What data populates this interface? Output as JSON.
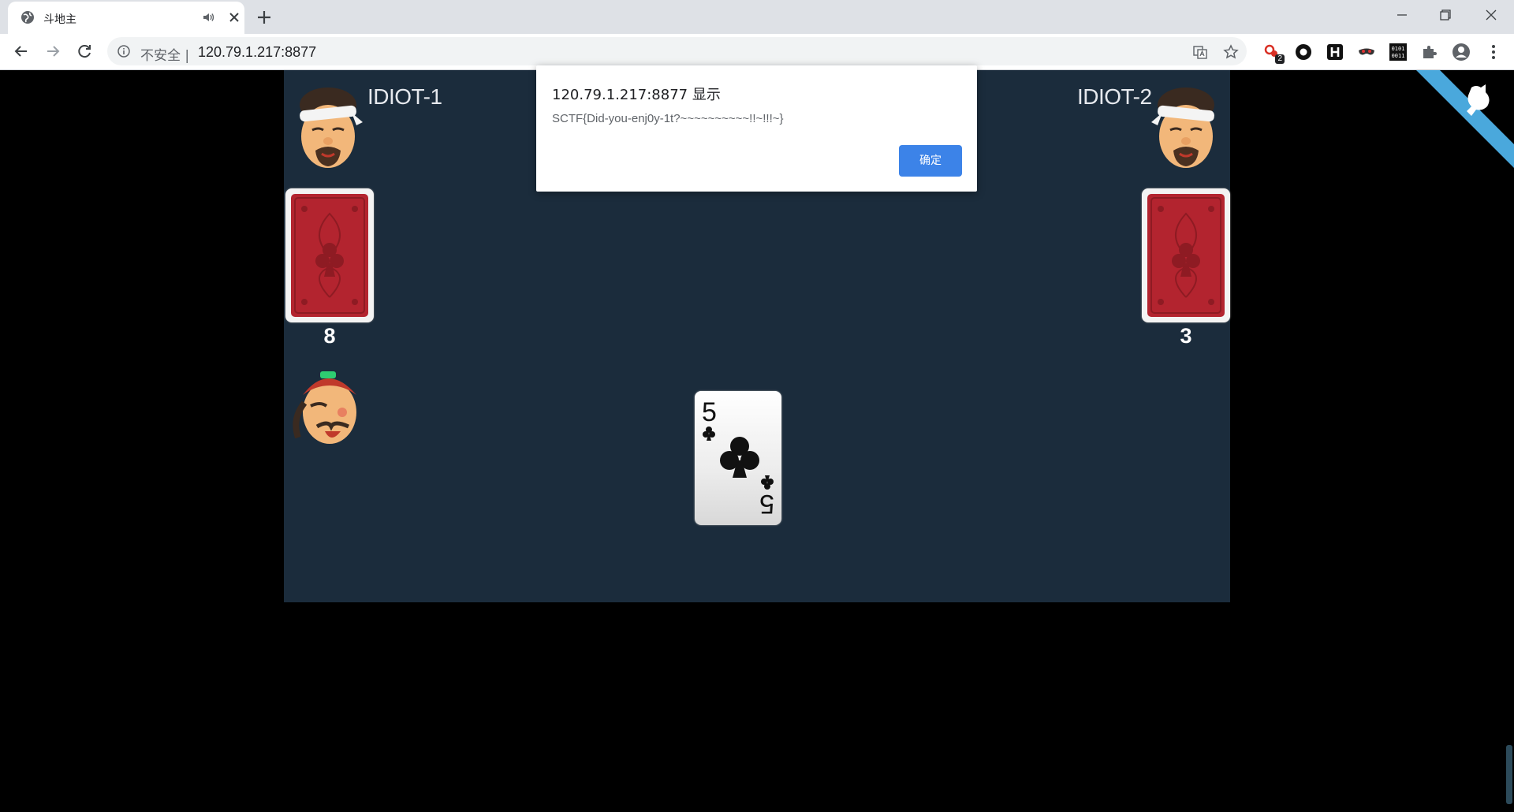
{
  "browser": {
    "tab_title": "斗地主",
    "security_label": "不安全 |",
    "url": "120.79.1.217:8877",
    "extension_badge": "2"
  },
  "alert": {
    "title": "120.79.1.217:8877 显示",
    "message": "SCTF{Did-you-enj0y-1t?~~~~~~~~~~!!~!!!~}",
    "ok_label": "确定"
  },
  "game": {
    "player_left": {
      "name": "IDIOT-1",
      "card_count": "8"
    },
    "player_right": {
      "name": "IDIOT-2",
      "card_count": "3"
    },
    "played_card": {
      "rank": "5",
      "suit": "clubs"
    },
    "colors": {
      "table": "#1b2c3c",
      "card_back": "#b3242f",
      "ribbon": "#4aa8dc",
      "ok_button": "#3c83e8"
    }
  }
}
